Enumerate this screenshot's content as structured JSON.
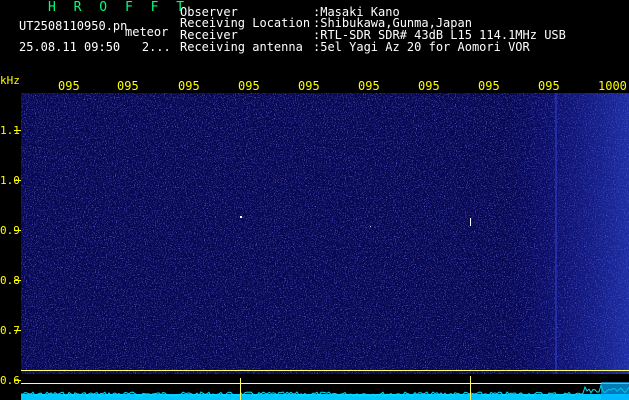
{
  "header": {
    "title": "H R O F F T",
    "filename": "UT2508110950.pn",
    "meteor_label": "meteor",
    "datetime": "25.08.11 09:50",
    "counter": "2..."
  },
  "info": [
    {
      "label": "Observer",
      "value": ":Masaki Kano"
    },
    {
      "label": "Receiving Location",
      "value": ":Shibukawa,Gunma,Japan"
    },
    {
      "label": "Receiver",
      "value": ":RTL-SDR SDR# 43dB L15 114.1MHz USB"
    },
    {
      "label": "Receiving antenna",
      "value": ":5el Yagi Az 20 for Aomori VOR"
    }
  ],
  "axis": {
    "unit": "kHz",
    "y_ticks": [
      "1.1",
      "1.0",
      "0.9",
      "0.8",
      "0.7",
      "0.6"
    ],
    "x_ticks": [
      "095",
      "095",
      "095",
      "095",
      "095",
      "095",
      "095",
      "095",
      "095",
      "1000"
    ]
  },
  "colors": {
    "background": "#000000",
    "waterfall": "#070752",
    "label_green": "#00ff7a",
    "axis_yellow": "#ffff00",
    "spectrum_cyan": "#00e5ff"
  }
}
